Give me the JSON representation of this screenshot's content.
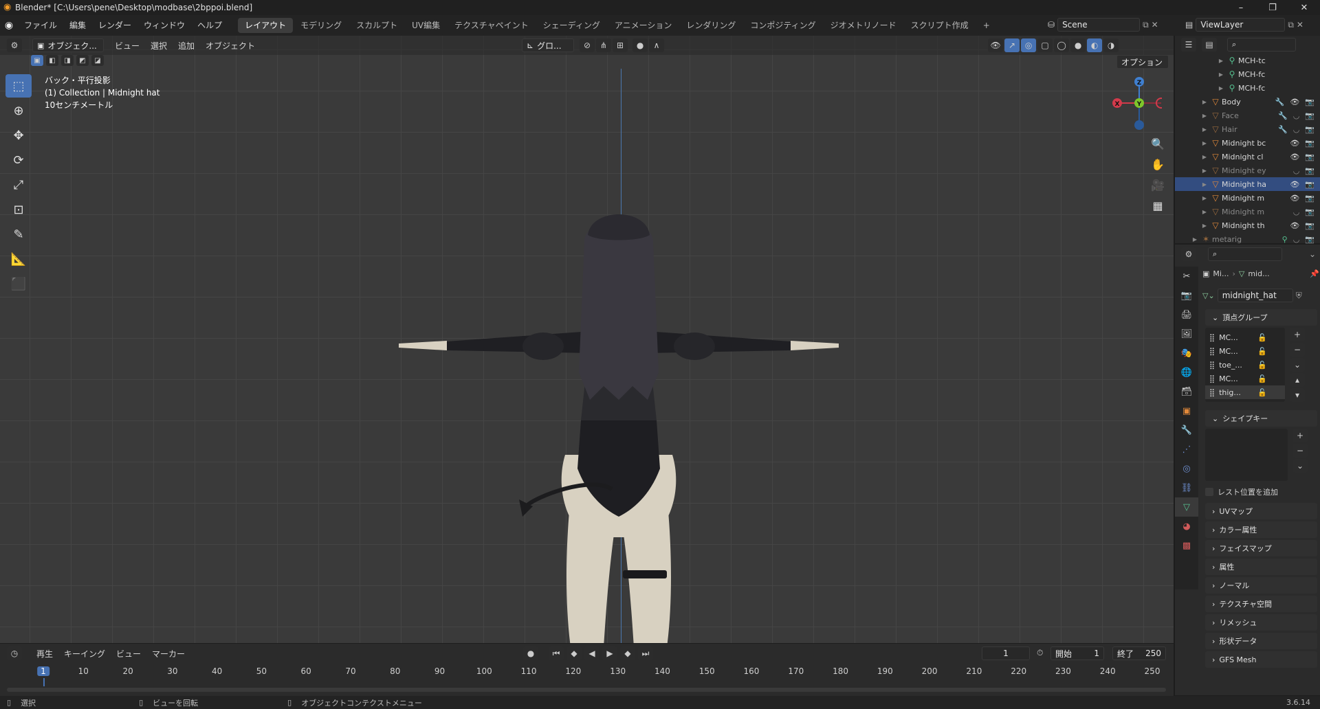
{
  "titlebar": {
    "title": "Blender* [C:\\Users\\pene\\Desktop\\modbase\\2bppoi.blend]"
  },
  "menubar": {
    "menus": [
      "ファイル",
      "編集",
      "レンダー",
      "ウィンドウ",
      "ヘルプ"
    ],
    "workspaces": [
      "レイアウト",
      "モデリング",
      "スカルプト",
      "UV編集",
      "テクスチャペイント",
      "シェーディング",
      "アニメーション",
      "レンダリング",
      "コンポジティング",
      "ジオメトリノード",
      "スクリプト作成"
    ],
    "scene": "Scene",
    "view_layer": "ViewLayer"
  },
  "viewport_header": {
    "mode": "オブジェク...",
    "menus": [
      "ビュー",
      "選択",
      "追加",
      "オブジェクト"
    ],
    "transform": "グロ...",
    "options": "オプション"
  },
  "viewport": {
    "overlay": [
      "バック・平行投影",
      "(1) Collection | Midnight hat",
      "10センチメートル"
    ],
    "gizmo": {
      "z": "Z",
      "y": "Y",
      "x": "X"
    }
  },
  "outliner": {
    "rows": [
      {
        "label": "MCH-tc",
        "dim": false
      },
      {
        "label": "MCH-fc",
        "dim": false
      },
      {
        "label": "MCH-fc",
        "dim": false
      },
      {
        "label": "Body",
        "dim": false
      },
      {
        "label": "Face",
        "dim": true
      },
      {
        "label": "Hair",
        "dim": true
      },
      {
        "label": "Midnight bc",
        "dim": false
      },
      {
        "label": "Midnight cl",
        "dim": false
      },
      {
        "label": "Midnight ey",
        "dim": true
      },
      {
        "label": "Midnight ha",
        "dim": false,
        "selected": true
      },
      {
        "label": "Midnight m",
        "dim": false
      },
      {
        "label": "Midnight m",
        "dim": true
      },
      {
        "label": "Midnight th",
        "dim": false
      },
      {
        "label": "metarig",
        "dim": true
      }
    ]
  },
  "properties": {
    "breadcrumb_obj": "Mi...",
    "breadcrumb_data": "mid...",
    "data_name": "midnight_hat",
    "vertex_groups_title": "頂点グループ",
    "vertex_groups": [
      "MC...",
      "MC...",
      "toe_...",
      "MC...",
      "thig..."
    ],
    "shape_keys_title": "シェイプキー",
    "add_rest_position": "レスト位置を追加",
    "panels": [
      "UVマップ",
      "カラー属性",
      "フェイスマップ",
      "属性",
      "ノーマル",
      "テクスチャ空間",
      "リメッシュ",
      "形状データ",
      "GFS Mesh"
    ]
  },
  "timeline": {
    "menus": [
      "再生",
      "キーイング",
      "ビュー",
      "マーカー"
    ],
    "current_frame": "1",
    "start_label": "開始",
    "start": "1",
    "end_label": "終了",
    "end": "250",
    "ticks": [
      "1",
      "10",
      "20",
      "30",
      "40",
      "50",
      "60",
      "70",
      "80",
      "90",
      "100",
      "110",
      "120",
      "130",
      "140",
      "150",
      "160",
      "170",
      "180",
      "190",
      "200",
      "210",
      "220",
      "230",
      "240",
      "250"
    ]
  },
  "statusbar": {
    "select": "選択",
    "rotate": "ビューを回転",
    "context": "オブジェクトコンテクストメニュー",
    "version": "3.6.14"
  }
}
